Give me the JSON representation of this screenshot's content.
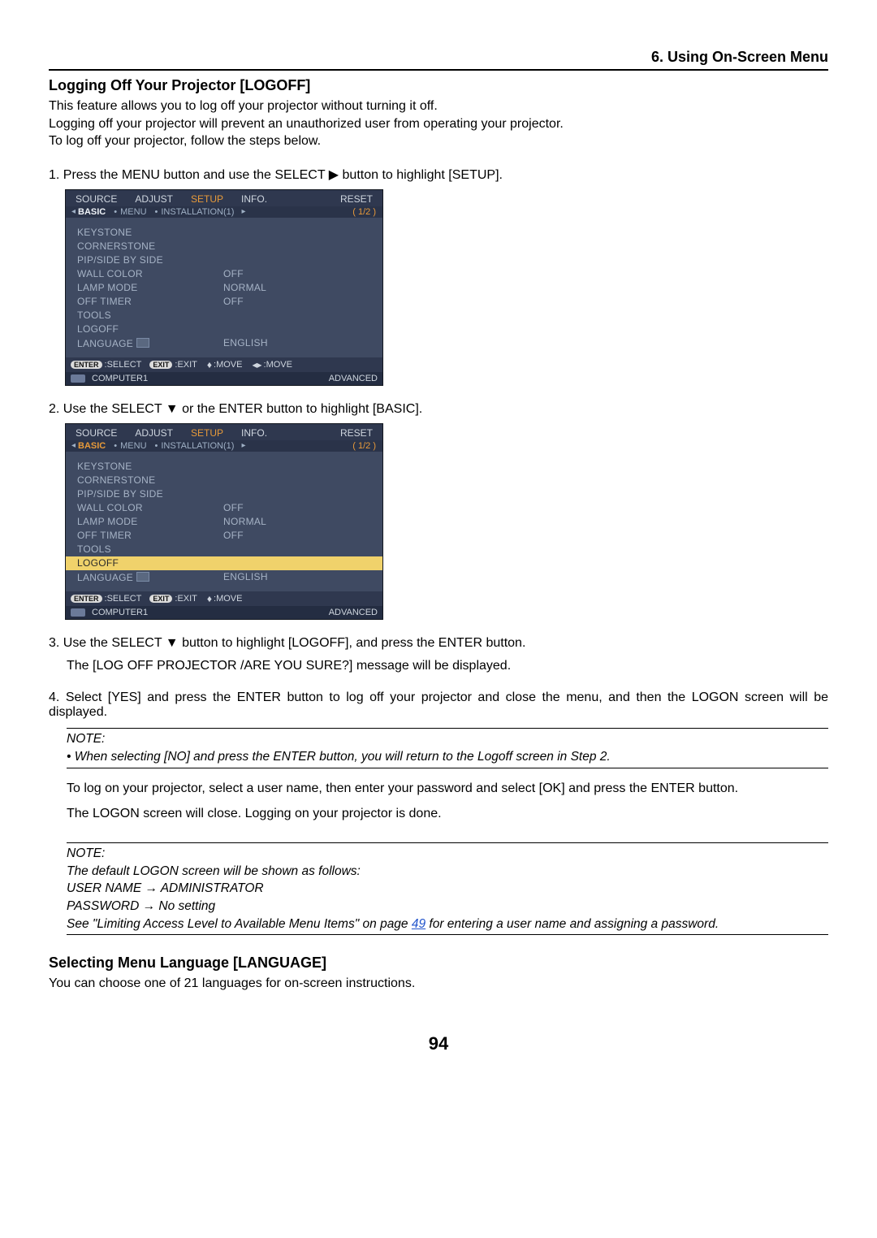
{
  "header": {
    "chapter": "6. Using On-Screen Menu"
  },
  "section1": {
    "title": "Logging Off Your Projector [LOGOFF]",
    "p1": "This feature allows you to log off your projector without turning it off.",
    "p2": "Logging off your projector will prevent an unauthorized user from operating your projector.",
    "p3": "To log off your projector, follow the steps below."
  },
  "steps": {
    "s1": "Press the MENU button and use the SELECT ▶ button to highlight [SETUP].",
    "s2": "Use the SELECT ▼ or the ENTER button to highlight [BASIC].",
    "s3": "Use the SELECT ▼ button to highlight [LOGOFF], and press the ENTER button.",
    "s3b": "The [LOG OFF PROJECTOR /ARE YOU SURE?] message will be displayed.",
    "s4": "Select [YES] and press the ENTER button to log off your projector and close the menu, and then the LOGON screen will be displayed."
  },
  "note1": {
    "title": "NOTE:",
    "line": "• When selecting [NO] and press the ENTER button, you will return to the Logoff screen in Step 2."
  },
  "after": {
    "p1": "To log on your projector, select a user name, then enter your password and select [OK] and press the ENTER button.",
    "p2": "The LOGON screen will close. Logging on your projector is done."
  },
  "note2": {
    "title": "NOTE:",
    "l1": "The default LOGON screen will be shown as follows:",
    "l2": "USER NAME → ADMINISTRATOR",
    "l3": "PASSWORD → No setting",
    "l4a": "See \"Limiting Access Level to Available Menu Items\" on page ",
    "l4link": "49",
    "l4b": " for entering a user name and assigning a password."
  },
  "section2": {
    "title": "Selecting Menu Language [LANGUAGE]",
    "p1": "You can choose one of 21 languages for on-screen instructions."
  },
  "page_number": "94",
  "menu": {
    "tabs": {
      "source": "SOURCE",
      "adjust": "ADJUST",
      "setup": "SETUP",
      "info": "INFO.",
      "reset": "RESET"
    },
    "subtabs": {
      "basic": "BASIC",
      "menu": "MENU",
      "install": "INSTALLATION(1)",
      "pager": "1/2"
    },
    "items": [
      {
        "label": "KEYSTONE",
        "value": ""
      },
      {
        "label": "CORNERSTONE",
        "value": ""
      },
      {
        "label": "PIP/SIDE BY SIDE",
        "value": ""
      },
      {
        "label": "WALL COLOR",
        "value": "OFF"
      },
      {
        "label": "LAMP MODE",
        "value": "NORMAL"
      },
      {
        "label": "OFF TIMER",
        "value": "OFF"
      },
      {
        "label": "TOOLS",
        "value": ""
      },
      {
        "label": "LOGOFF",
        "value": ""
      },
      {
        "label": "LANGUAGE",
        "value": "ENGLISH",
        "icon": true
      }
    ],
    "footer": {
      "enter": "ENTER",
      "select": ":SELECT",
      "exit": "EXIT",
      "exitl": ":EXIT",
      "move1": ":MOVE",
      "move2": ":MOVE"
    },
    "footer2": {
      "source": "COMPUTER1",
      "adv": "ADVANCED"
    }
  }
}
